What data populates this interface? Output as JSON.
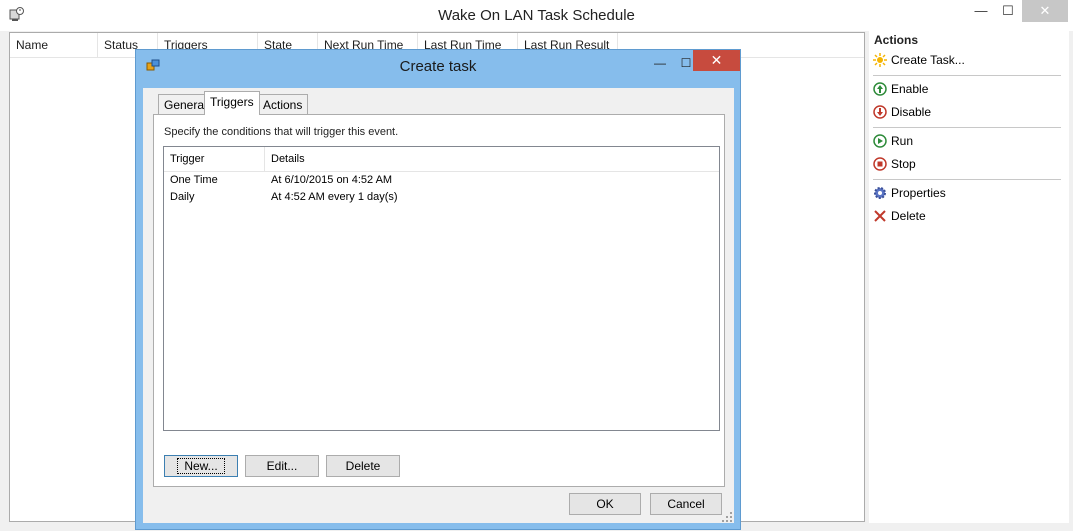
{
  "window": {
    "title": "Wake On LAN Task Schedule",
    "min": "—",
    "max": "☐",
    "close": "✕"
  },
  "tasklist": {
    "columns": [
      "Name",
      "Status",
      "Triggers",
      "State",
      "Next Run Time",
      "Last Run Time",
      "Last Run Result"
    ]
  },
  "actions": {
    "title": "Actions",
    "items": [
      {
        "label": "Create Task...",
        "icon": "sun-icon"
      },
      {
        "label": "Enable",
        "icon": "up-arrow-icon"
      },
      {
        "label": "Disable",
        "icon": "down-arrow-icon"
      },
      {
        "label": "Run",
        "icon": "play-icon"
      },
      {
        "label": "Stop",
        "icon": "stop-icon"
      },
      {
        "label": "Properties",
        "icon": "gear-icon"
      },
      {
        "label": "Delete",
        "icon": "delete-x-icon"
      }
    ]
  },
  "dialog": {
    "title": "Create task",
    "min": "—",
    "max": "☐",
    "close": "✕",
    "tabs": [
      "General",
      "Triggers",
      "Actions"
    ],
    "active_tab": "Triggers",
    "description": "Specify the conditions that will trigger this event.",
    "grid": {
      "columns": [
        "Trigger",
        "Details"
      ],
      "rows": [
        {
          "trigger": "One Time",
          "details": "At 6/10/2015 on 4:52 AM"
        },
        {
          "trigger": "Daily",
          "details": "At 4:52 AM every 1 day(s)"
        }
      ]
    },
    "buttons": {
      "new": "New...",
      "edit": "Edit...",
      "delete": "Delete",
      "ok": "OK",
      "cancel": "Cancel"
    }
  },
  "colors": {
    "dialog_frame": "#86bdec",
    "close_red": "#c74b3e"
  }
}
